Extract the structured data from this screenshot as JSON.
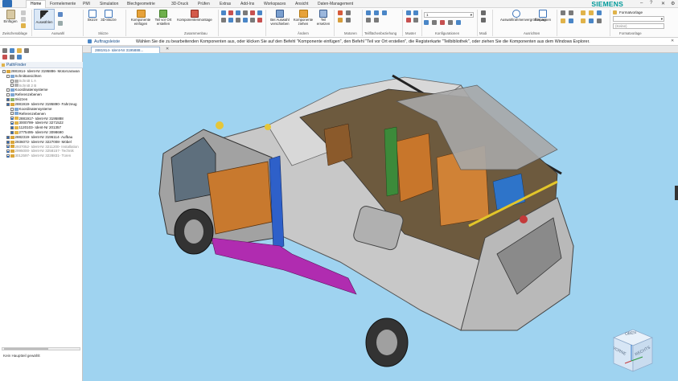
{
  "menu": {
    "tabs": [
      "Home",
      "Formelemente",
      "PMI",
      "Simulation",
      "Blechgeometrie",
      "3D-Druck",
      "Prüfen",
      "Extras",
      "Add-Ins",
      "Workspaces",
      "Ansicht",
      "Daten-Management"
    ],
    "active": "Home"
  },
  "brand": "SIEMENS",
  "ribbon": {
    "clipboard": {
      "paste": "Einfügen",
      "group": "Zwischenablage"
    },
    "select": {
      "label": "Auswählen",
      "group": "Auswahl"
    },
    "sketch": {
      "sketch": "Skizze",
      "sketch3d": "3D-Skizze",
      "group": "Skizze"
    },
    "assembly": {
      "insert": "Komponente einfügen",
      "create_in_place": "Teil vor Ort erstellen",
      "assembly_mount": "Komponentenmontage",
      "group": "Zusammenbau"
    },
    "modify": {
      "move": "Bei Auswahl verschieben",
      "drag": "Komponente ziehen",
      "replace": "Teil ersetzen",
      "group": "Ändern"
    },
    "motor": {
      "group": "Motoren"
    },
    "surface": {
      "group": "Teilflächenbeziehung"
    },
    "pattern": {
      "group": "Muster"
    },
    "config": {
      "value": "1",
      "group": "Konfigurationen"
    },
    "model": {
      "group": "Modi"
    },
    "align": {
      "fit_selection": "Auswahlrahmenvergrößerung",
      "fit": "Einpassen",
      "group": "Ausrichten"
    },
    "style": {
      "template": "Formatvorlage",
      "placeholder": "(Keine)",
      "group": "Formatvorlage"
    }
  },
  "cmdbar": {
    "prompt": "Auftragsleiste",
    "text": "Wählen Sie die zu bearbeitenden Komponenten aus, oder klicken Sie auf den Befehl \"Komponente einfügen\", den Befehl \"Teil vor Ort erstellen\", die Registerkarte \"Teilbibliothek\", oder ziehen Sie die Komponenten aus dem Windows Explorer."
  },
  "document_tab": "2881914-  Ident-Nr 3195888...",
  "pathfinder": {
    "title": "PathFinder",
    "items": [
      {
        "label": "2881914-  Ident-Nr 3195886- Motorcaravan",
        "indent": 0
      },
      {
        "label": "Schnittansichten",
        "indent": 1
      },
      {
        "label": "Schnitt 1 A",
        "indent": 2,
        "dim": true
      },
      {
        "label": "Schnitt 2 B",
        "indent": 2,
        "dim": true
      },
      {
        "label": "Koordinatensysteme",
        "indent": 1
      },
      {
        "label": "Referenzebenen",
        "indent": 1
      },
      {
        "label": "Skizzen",
        "indent": 1
      },
      {
        "label": "2881919-  Ident-Nr 3195890- Fahrzeug",
        "indent": 1
      },
      {
        "label": "Koordinatensysteme",
        "indent": 2
      },
      {
        "label": "Referenzebenen",
        "indent": 2
      },
      {
        "label": "2881917-  Ident-Nr 3195888",
        "indent": 2
      },
      {
        "label": "3000799-  Ident-Nr 3271522",
        "indent": 2
      },
      {
        "label": "1120103-  Ident-Nr 201357",
        "indent": 2
      },
      {
        "label": "2775495-  Ident-Nr 3098690",
        "indent": 2
      },
      {
        "label": "2882319-  Ident-Nr 3196114- Aufbau",
        "indent": 1
      },
      {
        "label": "2936072-  Ident-Nr 3227008- Möbel",
        "indent": 1
      },
      {
        "label": "2937052-  Ident-Nr 3211200- Installation",
        "indent": 1,
        "dim": true
      },
      {
        "label": "2995000-  Ident-Nr 3258157- Technik",
        "indent": 1,
        "dim": true
      },
      {
        "label": "3012597-  Ident-Nr 3228831- Türen",
        "indent": 1,
        "dim": true
      }
    ]
  },
  "status": "Kein Hauptteil gewählt",
  "viewcube": {
    "top": "OBEN",
    "front": "VORNE",
    "right": "RECHTS"
  },
  "colors": {
    "accent": "#009999",
    "viewport": "#9fd3f0",
    "ribbon_active": "#1b4f8a"
  }
}
